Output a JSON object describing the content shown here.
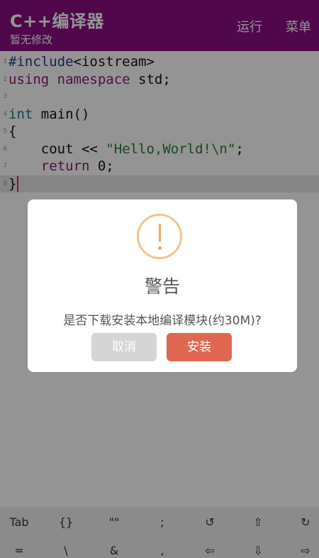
{
  "header": {
    "title": "C++编译器",
    "subtitle": "暂无修改",
    "run_label": "运行",
    "menu_label": "菜单"
  },
  "editor": {
    "lines": [
      {
        "num": "1",
        "parts": [
          {
            "t": "#include",
            "c": "kw-blue"
          },
          {
            "t": "<iostream>",
            "c": ""
          }
        ]
      },
      {
        "num": "2",
        "parts": [
          {
            "t": "using namespace",
            "c": "kw-purple"
          },
          {
            "t": " std;",
            "c": ""
          }
        ]
      },
      {
        "num": "3",
        "parts": []
      },
      {
        "num": "4",
        "parts": [
          {
            "t": "int",
            "c": "kw-teal"
          },
          {
            "t": " main()",
            "c": ""
          }
        ]
      },
      {
        "num": "5",
        "parts": [
          {
            "t": "{",
            "c": ""
          }
        ]
      },
      {
        "num": "6",
        "parts": [
          {
            "t": "    cout << ",
            "c": ""
          },
          {
            "t": "\"Hello,World!\\n\"",
            "c": "str"
          },
          {
            "t": ";",
            "c": ""
          }
        ]
      },
      {
        "num": "7",
        "parts": [
          {
            "t": "    ",
            "c": ""
          },
          {
            "t": "return",
            "c": "kw-purple"
          },
          {
            "t": " 0;",
            "c": ""
          }
        ]
      },
      {
        "num": "8",
        "parts": [
          {
            "t": "}",
            "c": ""
          }
        ]
      }
    ]
  },
  "dialog": {
    "title": "警告",
    "message": "是否下载安装本地编译模块(约30M)?",
    "cancel_label": "取消",
    "install_label": "安装"
  },
  "keyboard": {
    "row1": [
      "Tab",
      "{}",
      "\"\"",
      ";",
      "↺",
      "⇧",
      "↻"
    ],
    "row2": [
      "=",
      "\\",
      "&",
      ",",
      "⇦",
      "⇩",
      "⇨"
    ]
  }
}
